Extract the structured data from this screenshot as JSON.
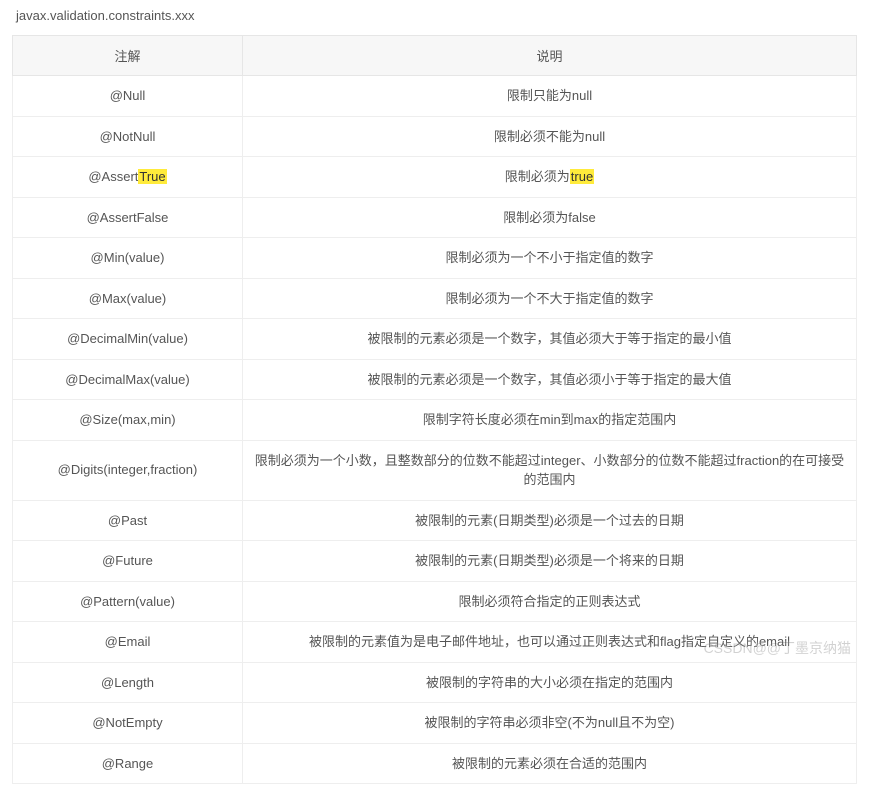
{
  "header": "javax.validation.constraints.xxx",
  "columns": {
    "annotation": "注解",
    "description": "说明"
  },
  "rows": [
    {
      "anno": "@Null",
      "desc": "限制只能为null"
    },
    {
      "anno": "@NotNull",
      "desc": "限制必须不能为null"
    },
    {
      "anno_prefix": "@Assert",
      "anno_hl": "True",
      "desc_prefix": "限制必须为",
      "desc_hl": "true"
    },
    {
      "anno": "@AssertFalse",
      "desc": "限制必须为false"
    },
    {
      "anno": "@Min(value)",
      "desc": "限制必须为一个不小于指定值的数字"
    },
    {
      "anno": "@Max(value)",
      "desc": "限制必须为一个不大于指定值的数字"
    },
    {
      "anno": "@DecimalMin(value)",
      "desc": "被限制的元素必须是一个数字，其值必须大于等于指定的最小值"
    },
    {
      "anno": "@DecimalMax(value)",
      "desc": "被限制的元素必须是一个数字，其值必须小于等于指定的最大值"
    },
    {
      "anno": "@Size(max,min)",
      "desc": "限制字符长度必须在min到max的指定范围内"
    },
    {
      "anno": "@Digits(integer,fraction)",
      "desc": "限制必须为一个小数，且整数部分的位数不能超过integer、小数部分的位数不能超过fraction的在可接受的范围内"
    },
    {
      "anno": "@Past",
      "desc": "被限制的元素(日期类型)必须是一个过去的日期"
    },
    {
      "anno": "@Future",
      "desc": "被限制的元素(日期类型)必须是一个将来的日期"
    },
    {
      "anno": "@Pattern(value)",
      "desc": "限制必须符合指定的正则表达式"
    },
    {
      "anno": "@Email",
      "desc": "被限制的元素值为是电子邮件地址，也可以通过正则表达式和flag指定自定义的email"
    },
    {
      "anno": "@Length",
      "desc": "被限制的字符串的大小必须在指定的范围内"
    },
    {
      "anno": "@NotEmpty",
      "desc": "被限制的字符串必须非空(不为null且不为空)"
    },
    {
      "anno": "@Range",
      "desc": "被限制的元素必须在合适的范围内"
    }
  ],
  "watermark": "CSSDN@@丁墨京纳猫"
}
